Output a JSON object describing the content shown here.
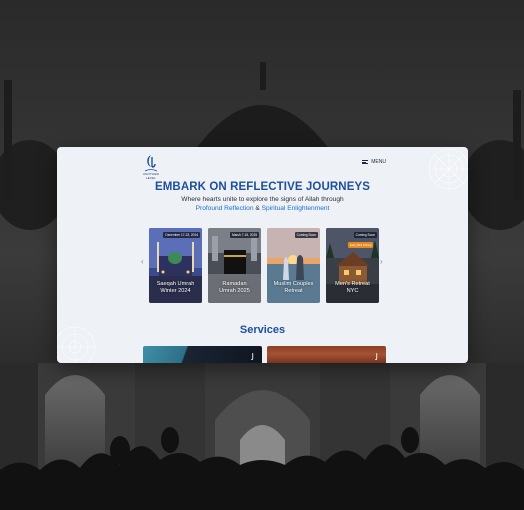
{
  "brand": {
    "logo_label": "ANOTHER LEVEL",
    "logo_icon": "crescent-script-logo-icon"
  },
  "nav": {
    "menu_label": "MENU",
    "menu_icon": "hamburger-icon"
  },
  "hero": {
    "headline": "EMBARK ON REFLECTIVE JOURNEYS",
    "subtitle_line1": "Where hearts unite to explore the signs of Allah through",
    "highlight1": "Profound Reflection",
    "connector": " & ",
    "highlight2": "Spiritual Enlightenment"
  },
  "carousel": {
    "prev_icon": "chevron-left-icon",
    "next_icon": "chevron-right-icon",
    "trips": [
      {
        "date": "December 17-23, 2024",
        "title_line1": "Saeqah Umrah",
        "title_line2": "Winter 2024"
      },
      {
        "date": "March 7-15, 2025",
        "title_line1": "Ramadan",
        "title_line2": "Umrah 2025"
      },
      {
        "date": "Coming Soon",
        "title_line1": "Muslim Couples",
        "title_line2": "Retreat"
      },
      {
        "date": "Coming Soon",
        "promo": "Early Bird Pricing",
        "title_line1": "Men's Retreat",
        "title_line2": "NYC"
      }
    ]
  },
  "services": {
    "title": "Services"
  },
  "colors": {
    "primary": "#1d4f9e",
    "accent": "#1e6fd0",
    "card_bg": "#eef1f5",
    "promo": "#e58a1e"
  }
}
